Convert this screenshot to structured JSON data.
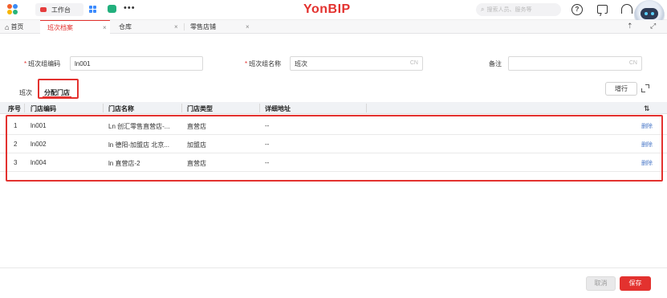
{
  "topbar": {
    "workbench_label": "工作台",
    "brand": "YonBIP",
    "search_placeholder": "搜索人员、服务等",
    "more": "•••",
    "help": "?",
    "brand_color": "#e3322f"
  },
  "tabs": [
    {
      "label": "首页"
    },
    {
      "label": "班次档案",
      "active": true
    },
    {
      "label": "仓库"
    },
    {
      "label": "零售店铺"
    }
  ],
  "tab_close": "×",
  "tab_right_icons": {
    "share": "⇡",
    "fullscreen": "⤢"
  },
  "form": {
    "code_label": "班次组编码",
    "code_value": "ln001",
    "name_label": "班次组名称",
    "name_value": "班次",
    "name_cn": "CN",
    "remark_label": "备注",
    "remark_value": "",
    "remark_cn": "CN",
    "required_mark": "*"
  },
  "subtabs": [
    {
      "label": "班次"
    },
    {
      "label": "分配门店",
      "active": true
    }
  ],
  "toolbar": {
    "add_row_label": "增行"
  },
  "table": {
    "headers": [
      "序号",
      "门店编码",
      "门店名称",
      "门店类型",
      "详细地址"
    ],
    "settings_icon": "⇅",
    "rows": [
      {
        "no": "1",
        "code": "ln001",
        "name": "Ln 创汇零售直营店-...",
        "type": "直营店",
        "address": "--",
        "action": "删除"
      },
      {
        "no": "2",
        "code": "ln002",
        "name": "ln 德阳-加盟店 北京...",
        "type": "加盟店",
        "address": "--",
        "action": "删除"
      },
      {
        "no": "3",
        "code": "ln004",
        "name": "ln 直营店-2",
        "type": "直营店",
        "address": "--",
        "action": "删除"
      }
    ]
  },
  "footer": {
    "cancel_label": "取消",
    "save_label": "保存"
  }
}
